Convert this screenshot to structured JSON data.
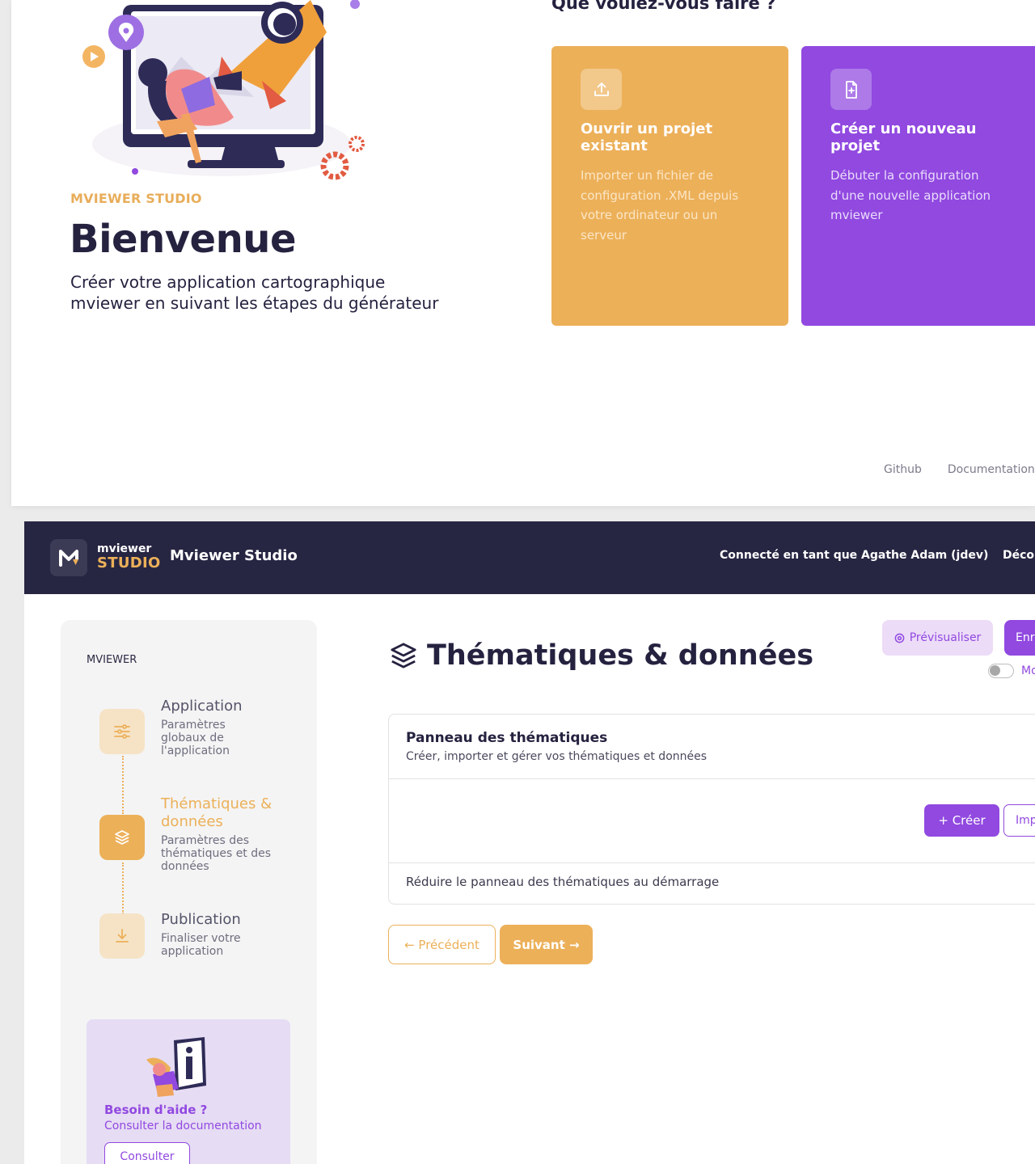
{
  "welcome": {
    "kicker": "MVIEWER STUDIO",
    "title": "Bienvenue",
    "subtitle": "Créer votre application cartographique mviewer en suivant les étapes du générateur",
    "question": "Que voulez-vous faire ?",
    "cards": [
      {
        "title": "Ouvrir un projet existant",
        "description": "Importer un fichier de configuration .XML depuis votre ordinateur ou un serveur",
        "icon": "upload-icon"
      },
      {
        "title": "Créer un nouveau projet",
        "description": "Débuter la configuration d'une nouvelle application mviewer",
        "icon": "new-file-icon"
      }
    ],
    "footer": {
      "github": "Github",
      "documentation": "Documentation"
    }
  },
  "navbar": {
    "logo_top": "mviewer",
    "logo_bottom": "STUDIO",
    "app_name": "Mviewer Studio",
    "connected": "Connecté en tant que Agathe Adam (jdev)",
    "logout": "Déconnexion"
  },
  "sidebar": {
    "heading": "MVIEWER",
    "steps": [
      {
        "title": "Application",
        "description": "Paramètres globaux de l'application",
        "icon": "sliders-icon",
        "active": false
      },
      {
        "title": "Thématiques & données",
        "description": "Paramètres des thématiques et des données",
        "icon": "layers-icon",
        "active": true
      },
      {
        "title": "Publication",
        "description": "Finaliser votre application",
        "icon": "download-icon",
        "active": false
      }
    ],
    "help": {
      "title": "Besoin d'aide ?",
      "subtitle": "Consulter la documentation",
      "button": "Consulter"
    }
  },
  "main": {
    "title": "Thématiques & données",
    "preview_label": "Prévisualiser",
    "save_label": "Enregistrer",
    "toggle_label": "Mode avancé",
    "panel": {
      "title": "Panneau des thématiques",
      "subtitle": "Créer, importer et gérer vos thématiques et données",
      "create_label": "+ Créer",
      "import_label": "Importer",
      "footer_label": "Réduire le panneau des thématiques au démarrage"
    },
    "prev_label": "← Précédent",
    "next_label": "Suivant →"
  },
  "colors": {
    "navy": "#262542",
    "orange": "#ecb059",
    "purple": "#9149e0"
  }
}
